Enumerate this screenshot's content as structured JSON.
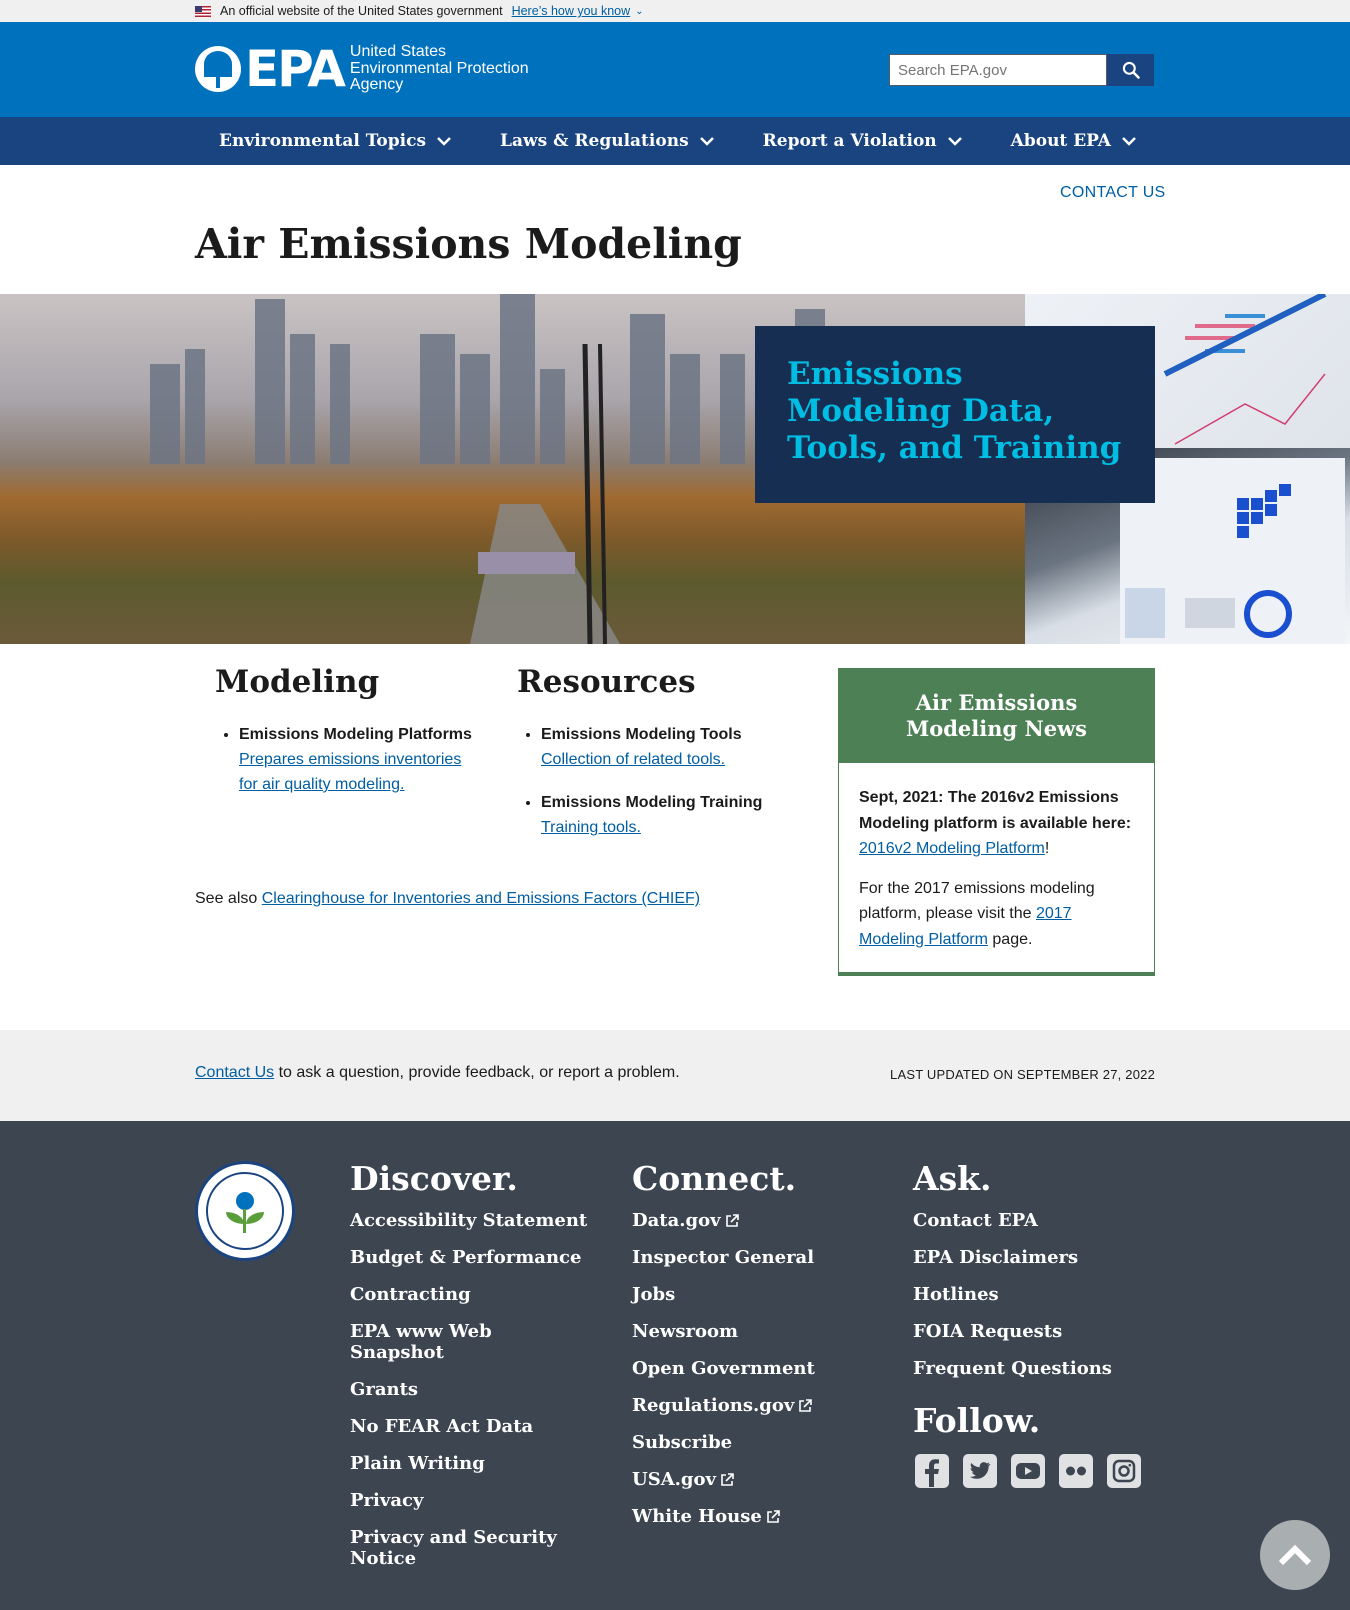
{
  "gov_banner": {
    "official_text": "An official website of the United States government",
    "how_you_know": "Here’s how you know"
  },
  "header": {
    "logo_letters": "EPA",
    "logo_sub": [
      "United States",
      "Environmental Protection",
      "Agency"
    ],
    "search_placeholder": "Search EPA.gov",
    "colors": {
      "header_bg": "#0071bc",
      "nav_bg": "#1a4480"
    }
  },
  "nav": {
    "items": [
      {
        "label": "Environmental Topics"
      },
      {
        "label": "Laws & Regulations"
      },
      {
        "label": "Report a Violation"
      },
      {
        "label": "About EPA"
      }
    ]
  },
  "contact_top": "CONTACT US",
  "page_title": "Air Emissions Modeling",
  "hero": {
    "heading": "Emissions Modeling Data, Tools, and Training"
  },
  "modeling": {
    "heading": "Modeling",
    "items": [
      {
        "title": "Emissions Modeling Platforms",
        "link": "Prepares emissions inventories for air quality modeling."
      }
    ]
  },
  "resources": {
    "heading": "Resources",
    "items": [
      {
        "title": "Emissions Modeling Tools",
        "link": "Collection of related tools."
      },
      {
        "title": "Emissions Modeling Training",
        "link": "Training tools."
      }
    ]
  },
  "see_also": {
    "prefix": "See also ",
    "link": "Clearinghouse for Inventories and Emissions Factors (CHIEF)"
  },
  "news": {
    "heading": "Air Emissions Modeling News",
    "p1_bold": "Sept, 2021: The 2016v2 Emissions Modeling platform is available here: ",
    "p1_link": "2016v2 Modeling Platform",
    "p1_end": "!",
    "p2_start": "For the 2017 emissions modeling platform, please visit the ",
    "p2_link": "2017 Modeling Platform",
    "p2_end": " page."
  },
  "footer_bar": {
    "contact_link": "Contact Us",
    "contact_rest": " to ask a question, provide feedback, or report a problem.",
    "last_updated": "LAST UPDATED ON SEPTEMBER 27, 2022"
  },
  "footer": {
    "discover": {
      "heading": "Discover.",
      "links": [
        "Accessibility Statement",
        "Budget & Performance",
        "Contracting",
        "EPA www Web Snapshot",
        "Grants",
        "No FEAR Act Data",
        "Plain Writing",
        "Privacy",
        "Privacy and Security Notice"
      ]
    },
    "connect": {
      "heading": "Connect.",
      "links": [
        "Data.gov",
        "Inspector General",
        "Jobs",
        "Newsroom",
        "Open Government",
        "Regulations.gov",
        "Subscribe",
        "USA.gov",
        "White House"
      ]
    },
    "ask": {
      "heading": "Ask.",
      "links": [
        "Contact EPA",
        "EPA Disclaimers",
        "Hotlines",
        "FOIA Requests",
        "Frequent Questions"
      ]
    },
    "follow": {
      "heading": "Follow.",
      "icons": [
        "facebook-icon",
        "twitter-icon",
        "youtube-icon",
        "flickr-icon",
        "instagram-icon"
      ]
    }
  }
}
